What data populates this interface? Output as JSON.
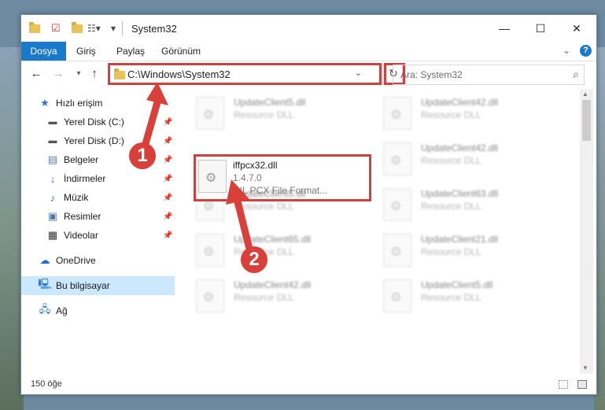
{
  "window": {
    "title": "System32",
    "controls": {
      "minimize": "—",
      "maximize": "☐",
      "close": "✕"
    }
  },
  "ribbon": {
    "tabs": [
      "Dosya",
      "Giriş",
      "Paylaş",
      "Görünüm"
    ]
  },
  "address": {
    "path": "C:\\Windows\\System32",
    "search_placeholder": "Ara: System32"
  },
  "sidebar": {
    "items": [
      {
        "label": "Hızlı erişim",
        "icon": "star-icon",
        "pinned": false
      },
      {
        "label": "Yerel Disk (C:)",
        "icon": "drive-icon",
        "pinned": true
      },
      {
        "label": "Yerel Disk (D:)",
        "icon": "drive-icon",
        "pinned": true
      },
      {
        "label": "Belgeler",
        "icon": "documents-icon",
        "pinned": true
      },
      {
        "label": "İndirmeler",
        "icon": "download-icon",
        "pinned": true
      },
      {
        "label": "Müzik",
        "icon": "music-icon",
        "pinned": true
      },
      {
        "label": "Resimler",
        "icon": "pictures-icon",
        "pinned": true
      },
      {
        "label": "Videolar",
        "icon": "videos-icon",
        "pinned": true
      },
      {
        "label": "OneDrive",
        "icon": "cloud-icon",
        "pinned": false
      },
      {
        "label": "Bu bilgisayar",
        "icon": "computer-icon",
        "pinned": false,
        "selected": true
      },
      {
        "label": "Ağ",
        "icon": "network-icon",
        "pinned": false
      }
    ]
  },
  "files": {
    "highlighted": {
      "name": "iffpcx32.dll",
      "version": "1.4.7.0",
      "description": "HIL PCX File Format..."
    },
    "background": [
      {
        "name": "UpdateClient5.dll",
        "type": "Resource DLL"
      },
      {
        "name": "UpdateClient42.dll",
        "type": "Resource DLL"
      },
      {
        "name": "UpdateClient42.dll",
        "type": "Resource DLL"
      },
      {
        "name": "UpdateClient63.dll",
        "type": "Resource DLL"
      },
      {
        "name": "UpdateClient5.dll",
        "type": "Resource DLL"
      },
      {
        "name": "UpdateClient65.dll",
        "type": "Resource DLL"
      },
      {
        "name": "UpdateClient21.dll",
        "type": "Resource DLL"
      },
      {
        "name": "UpdateClient42.dll",
        "type": "Resource DLL"
      },
      {
        "name": "UpdateClient5.dll",
        "type": "Resource DLL"
      }
    ]
  },
  "annotations": {
    "step1": "1",
    "step2": "2",
    "color": "#d9403a"
  },
  "status": {
    "item_count": "150 öğe"
  }
}
